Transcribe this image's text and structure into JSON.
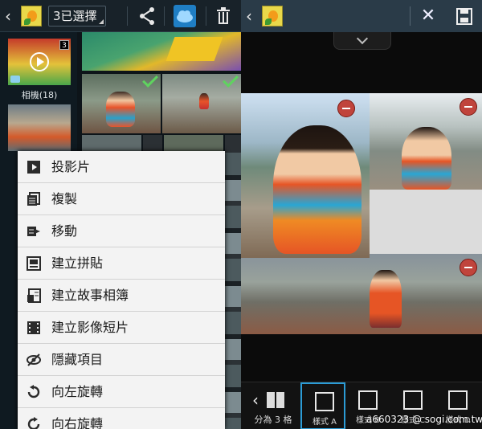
{
  "left_panel": {
    "selection_label": "3已選擇",
    "album": {
      "count_badge": "3",
      "label": "相機(18)"
    },
    "context_menu": [
      {
        "label": "投影片",
        "icon": "slideshow-icon"
      },
      {
        "label": "複製",
        "icon": "copy-icon"
      },
      {
        "label": "移動",
        "icon": "move-icon"
      },
      {
        "label": "建立拼貼",
        "icon": "collage-icon"
      },
      {
        "label": "建立故事相簿",
        "icon": "story-album-icon"
      },
      {
        "label": "建立影像短片",
        "icon": "video-clip-icon"
      },
      {
        "label": "隱藏項目",
        "icon": "hide-icon"
      },
      {
        "label": "向左旋轉",
        "icon": "rotate-left-icon"
      },
      {
        "label": "向右旋轉",
        "icon": "rotate-right-icon"
      }
    ]
  },
  "right_panel": {
    "toolbar": [
      {
        "label": "分為 3 格"
      },
      {
        "label": "樣式 A"
      },
      {
        "label": "樣式 B"
      },
      {
        "label": "樣式 C"
      },
      {
        "label": "樣式 D"
      }
    ]
  },
  "watermark": "a660323 @ sogi.com.tw",
  "colors": {
    "accent": "#2c9cd6",
    "check": "#5fd35f",
    "remove": "#c0443c"
  }
}
